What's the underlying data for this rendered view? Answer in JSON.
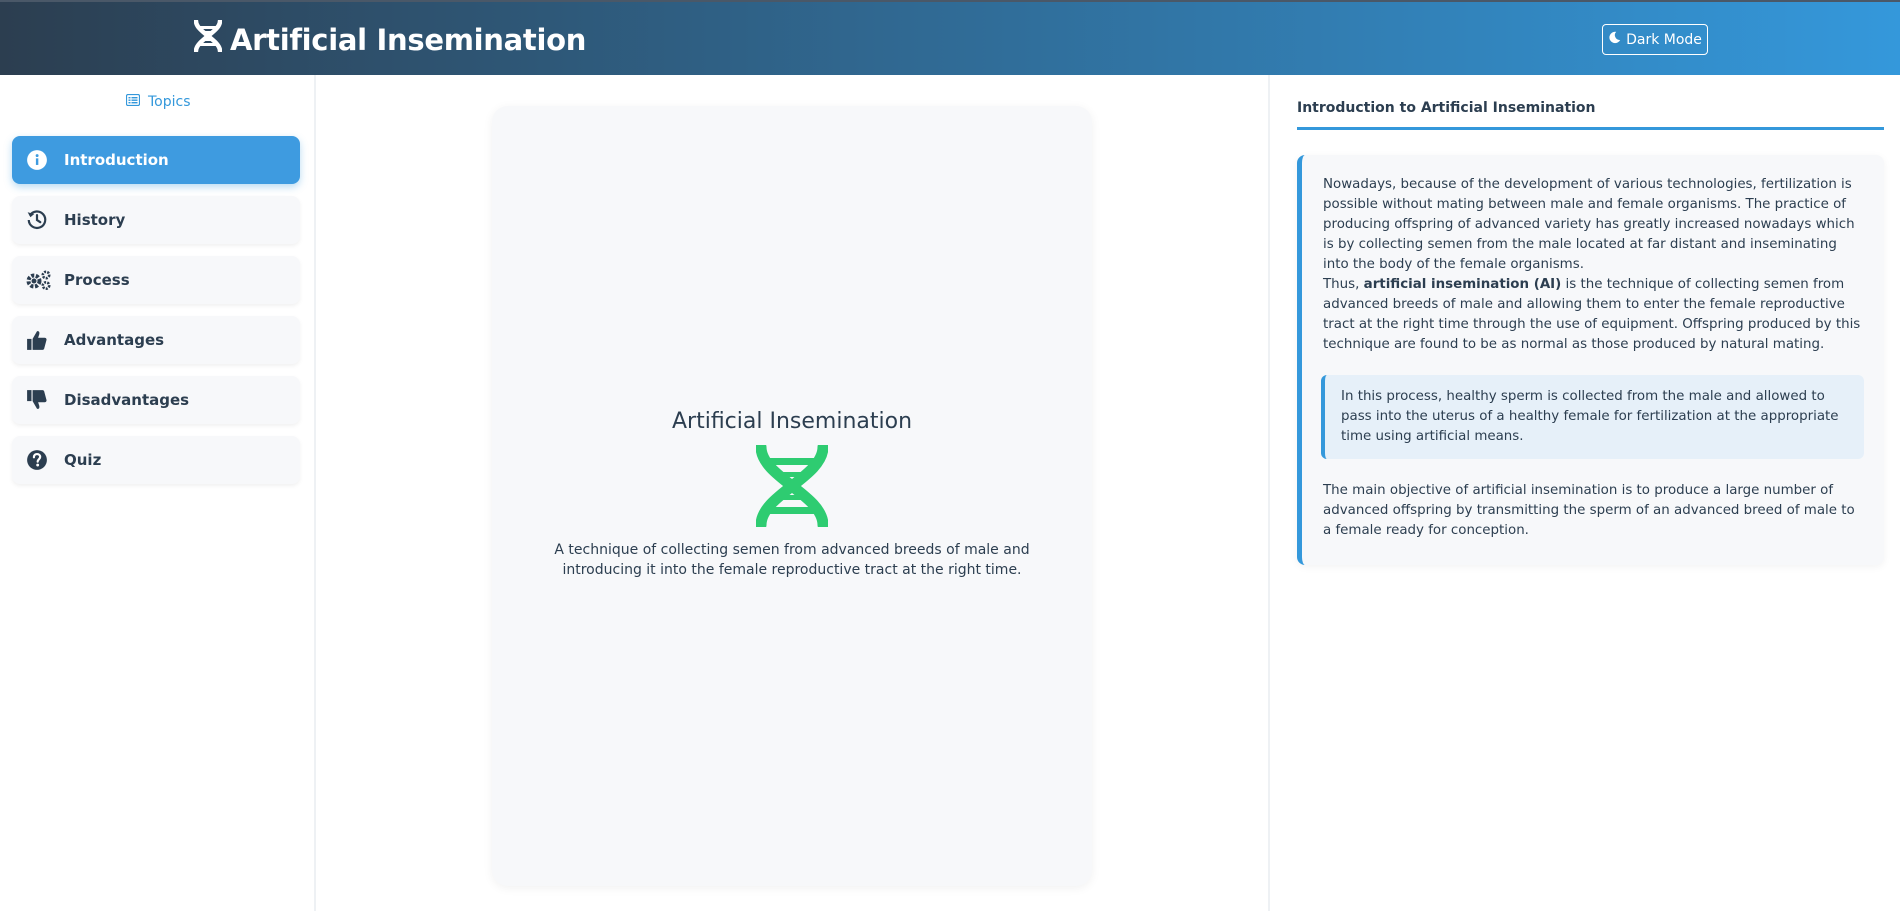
{
  "header": {
    "title": "Artificial Insemination",
    "dark_mode_label": "Dark Mode"
  },
  "sidebar": {
    "heading": "Topics",
    "items": [
      {
        "label": "Introduction",
        "icon": "info-circle-icon",
        "active": true
      },
      {
        "label": "History",
        "icon": "history-icon",
        "active": false
      },
      {
        "label": "Process",
        "icon": "gears-icon",
        "active": false
      },
      {
        "label": "Advantages",
        "icon": "thumbs-up-icon",
        "active": false
      },
      {
        "label": "Disadvantages",
        "icon": "thumbs-down-icon",
        "active": false
      },
      {
        "label": "Quiz",
        "icon": "question-circle-icon",
        "active": false
      }
    ]
  },
  "center": {
    "title": "Artificial Insemination",
    "icon": "dna-icon",
    "description": "A technique of collecting semen from advanced breeds of male and introducing it into the female reproductive tract at the right time."
  },
  "panel": {
    "title": "Introduction to Artificial Insemination",
    "para1": "Nowadays, because of the development of various technologies, fertilization is possible without mating between male and female organisms. The practice of producing offspring of advanced variety has greatly increased nowadays which is by collecting semen from the male located at far distant and inseminating into the body of the female organisms.",
    "para2_prefix": "Thus, ",
    "para2_bold": "artificial insemination (AI)",
    "para2_rest": " is the technique of collecting semen from advanced breeds of male and allowing them to enter the female reproductive tract at the right time through the use of equipment. Offspring produced by this technique are found to be as normal as those produced by natural mating.",
    "highlight": "In this process, healthy sperm is collected from the male and allowed to pass into the uterus of a healthy female for fertilization at the appropriate time using artificial means.",
    "para3": "The main objective of artificial insemination is to produce a large number of advanced offspring by transmitting the sperm of an advanced breed of male to a female ready for conception."
  },
  "colors": {
    "accent": "#3498db",
    "header_dark": "#2c3e50",
    "dna_green": "#2ecc71",
    "text": "#2c3e50"
  }
}
